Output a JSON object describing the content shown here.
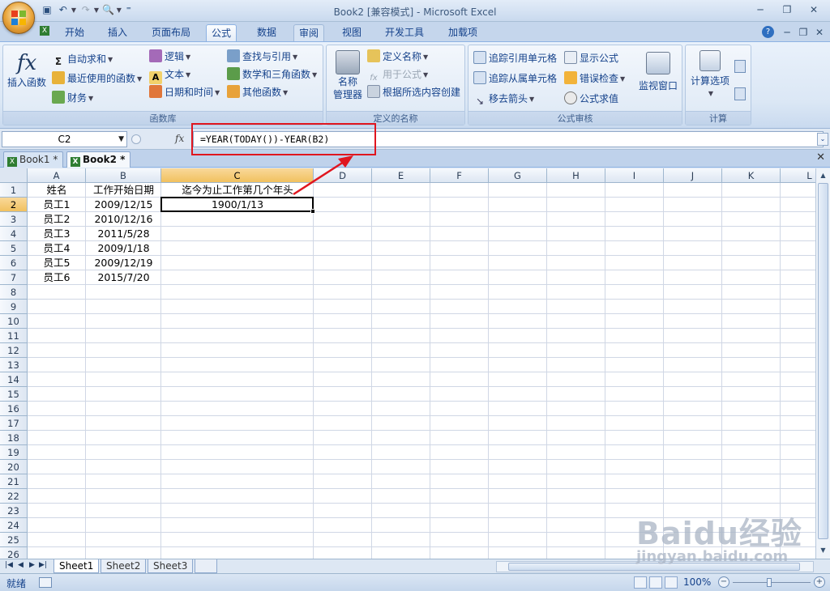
{
  "window": {
    "title": "Book2  [兼容模式] - Microsoft Excel"
  },
  "tabs": [
    {
      "label": "开始"
    },
    {
      "label": "插入"
    },
    {
      "label": "页面布局"
    },
    {
      "label": "公式"
    },
    {
      "label": "数据"
    },
    {
      "label": "审阅"
    },
    {
      "label": "视图"
    },
    {
      "label": "开发工具"
    },
    {
      "label": "加载项"
    }
  ],
  "ribbon": {
    "function_library": {
      "label": "函数库",
      "insert_function": "插入函数",
      "autosum": "自动求和",
      "recent": "最近使用的函数",
      "finance": "财务",
      "logic": "逻辑",
      "text": "文本",
      "datetime": "日期和时间",
      "lookup": "查找与引用",
      "math": "数学和三角函数",
      "other": "其他函数"
    },
    "defined_names": {
      "label": "定义的名称",
      "name_manager_1": "名称",
      "name_manager_2": "管理器",
      "define_name": "定义名称",
      "use_in_formula": "用于公式",
      "create_from_selection": "根据所选内容创建"
    },
    "formula_auditing": {
      "label": "公式审核",
      "trace_precedents": "追踪引用单元格",
      "trace_dependents": "追踪从属单元格",
      "remove_arrows": "移去箭头",
      "show_formulas": "显示公式",
      "error_checking": "错误检查",
      "evaluate": "公式求值",
      "watch_window": "监视窗口"
    },
    "calculation": {
      "label": "计算",
      "options": "计算选项"
    }
  },
  "formula_bar": {
    "name_box": "C2",
    "fx": "fx",
    "formula": "=YEAR(TODAY())-YEAR(B2)"
  },
  "workbooks": [
    {
      "label": "Book1 *"
    },
    {
      "label": "Book2 *"
    }
  ],
  "columns": [
    "A",
    "B",
    "C",
    "D",
    "E",
    "F",
    "G",
    "H",
    "I",
    "J",
    "K",
    "L"
  ],
  "rows": [
    "1",
    "2",
    "3",
    "4",
    "5",
    "6",
    "7",
    "8",
    "9",
    "10",
    "11",
    "12",
    "13",
    "14",
    "15",
    "16",
    "17",
    "18",
    "19",
    "20",
    "21",
    "22",
    "23",
    "24",
    "25",
    "26"
  ],
  "cells": {
    "headers": [
      "姓名",
      "工作开始日期",
      "迄今为止工作第几个年头"
    ],
    "data": [
      [
        "员工1",
        "2009/12/15",
        "1900/1/13"
      ],
      [
        "员工2",
        "2010/12/16",
        ""
      ],
      [
        "员工3",
        "2011/5/28",
        ""
      ],
      [
        "员工4",
        "2009/1/18",
        ""
      ],
      [
        "员工5",
        "2009/12/19",
        ""
      ],
      [
        "员工6",
        "2015/7/20",
        ""
      ]
    ]
  },
  "sheets": [
    {
      "label": "Sheet1"
    },
    {
      "label": "Sheet2"
    },
    {
      "label": "Sheet3"
    }
  ],
  "status": {
    "ready": "就绪",
    "zoom": "100%"
  },
  "watermark": {
    "main": "Baidu经验",
    "sub": "jingyan.baidu.com"
  },
  "colors": {
    "annotation": "#e0161f",
    "selected_header": "#f1c15f"
  }
}
